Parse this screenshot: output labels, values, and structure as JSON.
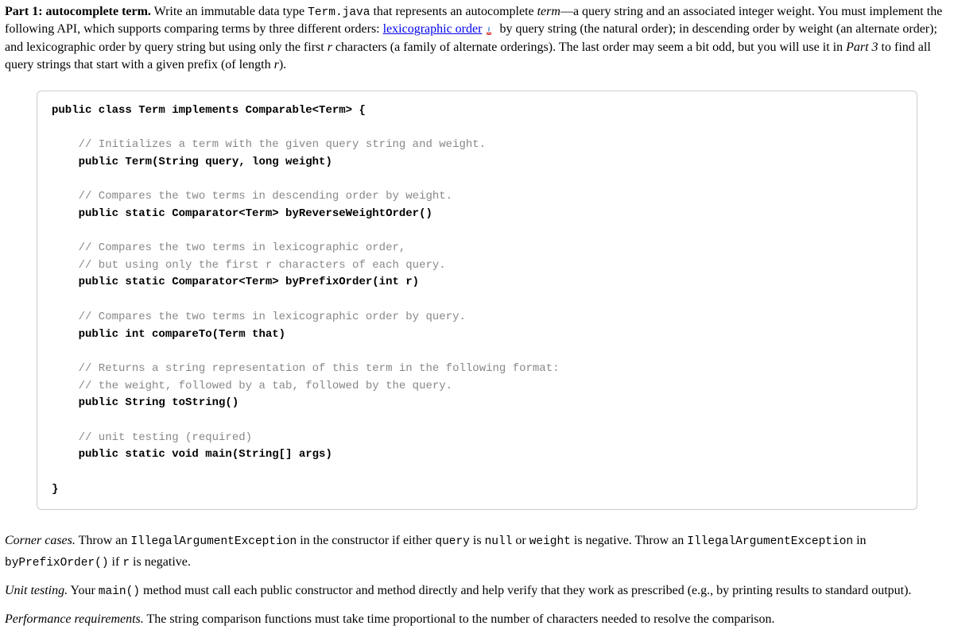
{
  "intro": {
    "lead_bold": "Part 1: autocomplete term.",
    "p1_a": " Write an immutable data type ",
    "term_java": "Term.java",
    "p1_b": " that represents an autocomplete ",
    "term_italic": "term",
    "p1_c": "—a query string and an associated integer weight. You must implement the following API, which supports comparing terms by three different orders: ",
    "link_text": "lexicographic order",
    "p1_d": " by query string (the natural order); in descending order by weight (an alternate order); and lexicographic order by query string but using only the first ",
    "r1": "r",
    "p1_e": " characters (a family of alternate orderings). The last order may seem a bit odd, but you will use it in ",
    "part3": "Part 3",
    "p1_f": " to find all query strings that start with a given prefix (of length ",
    "r2": "r",
    "p1_g": ")."
  },
  "code": {
    "l1": "public class Term implements Comparable<Term> {",
    "c1": "    // Initializes a term with the given query string and weight.",
    "s1": "    public Term(String query, long weight)",
    "c2": "    // Compares the two terms in descending order by weight.",
    "s2": "    public static Comparator<Term> byReverseWeightOrder()",
    "c3a": "    // Compares the two terms in lexicographic order,",
    "c3b": "    // but using only the first r characters of each query.",
    "s3": "    public static Comparator<Term> byPrefixOrder(int r)",
    "c4": "    // Compares the two terms in lexicographic order by query.",
    "s4": "    public int compareTo(Term that)",
    "c5a": "    // Returns a string representation of this term in the following format:",
    "c5b": "    // the weight, followed by a tab, followed by the query.",
    "s5": "    public String toString()",
    "c6": "    // unit testing (required)",
    "s6": "    public static void main(String[] args)",
    "l2": "}"
  },
  "corner": {
    "label": "Corner cases.",
    "a": "  Throw an ",
    "ex1": "IllegalArgumentException",
    "b": " in the constructor if either ",
    "q": "query",
    "c": " is ",
    "nul": "null",
    "d": " or ",
    "w": "weight",
    "e": " is negative. Throw an ",
    "ex2": "IllegalArgumentException",
    "f": " in ",
    "bp": "byPrefixOrder()",
    "g": " if ",
    "r": "r",
    "h": " is negative."
  },
  "unit": {
    "label": "Unit testing.",
    "a": "  Your ",
    "main": "main()",
    "b": " method must call each public constructor and method directly and help verify that they work as prescribed (e.g., by printing results to standard output)."
  },
  "perf": {
    "label": "Performance requirements.",
    "a": "  The string comparison functions must take time proportional to the number of characters needed to resolve the comparison."
  }
}
